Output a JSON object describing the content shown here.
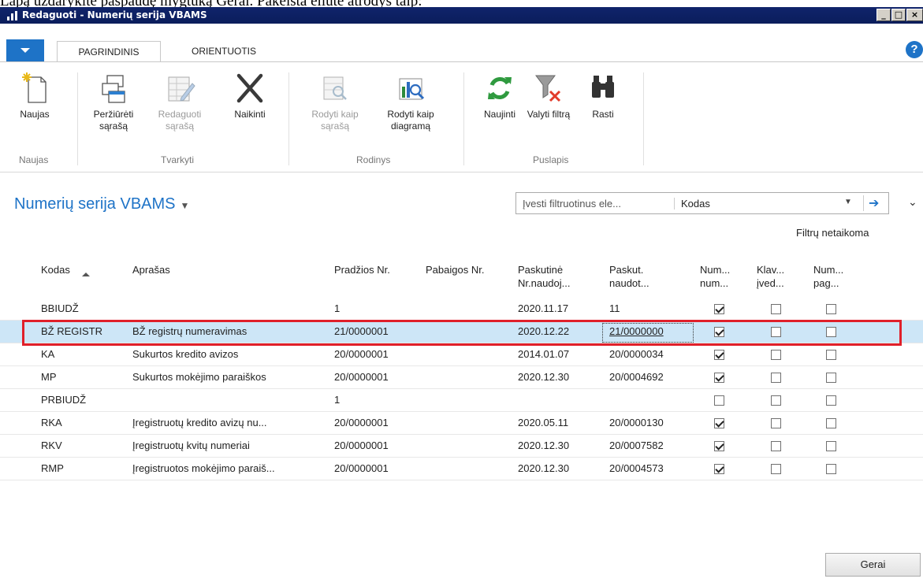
{
  "caption": "Lapą uždarykite paspaudę mygtuką Gerai. Pakeista eilutė atrodys taip:",
  "window": {
    "title": "Redaguoti - Numerių serija VBAMS",
    "controls": [
      "_",
      "□",
      "×"
    ]
  },
  "tabs": [
    {
      "label": "PAGRINDINIS",
      "active": true
    },
    {
      "label": "ORIENTUOTIS",
      "active": false
    }
  ],
  "help_label": "?",
  "ribbon": {
    "buttons": [
      {
        "label": "Naujas",
        "icon": "new-document-icon"
      },
      {
        "label": "Peržiūrėti sąrašą",
        "icon": "view-list-icon"
      },
      {
        "label": "Redaguoti sąrašą",
        "icon": "edit-list-icon",
        "disabled": true
      },
      {
        "label": "Naikinti",
        "icon": "delete-x-icon"
      },
      {
        "label": "Rodyti kaip sąrašą",
        "icon": "show-as-list-icon",
        "disabled": true
      },
      {
        "label": "Rodyti kaip diagramą",
        "icon": "show-as-chart-icon"
      },
      {
        "label": "Naujinti",
        "icon": "refresh-icon"
      },
      {
        "label": "Valyti filtrą",
        "icon": "clear-filter-icon"
      },
      {
        "label": "Rasti",
        "icon": "binoculars-icon"
      }
    ],
    "groups": [
      "Naujas",
      "Tvarkyti",
      "Rodinys",
      "Puslapis"
    ]
  },
  "page_title": "Numerių serija VBAMS",
  "filter": {
    "placeholder": "Įvesti filtruotinus ele...",
    "field": "Kodas",
    "status": "Filtrų netaikoma"
  },
  "columns": [
    "Kodas",
    "Aprašas",
    "Pradžios Nr.",
    "Pabaigos Nr.",
    "Paskutinė Nr.naudoj...",
    "Paskut. naudot...",
    "Num... num...",
    "Klav... įved...",
    "Num... pag..."
  ],
  "rows": [
    {
      "kodas": "BBIUDŽ",
      "aprasas": "",
      "pradzios": "1",
      "pabaigos": "",
      "data": "2020.11.17",
      "paskut": "11",
      "c1": true,
      "c2": false,
      "c3": false
    },
    {
      "kodas": "BŽ REGISTR",
      "aprasas": "BŽ registrų numeravimas",
      "pradzios": "21/0000001",
      "pabaigos": "",
      "data": "2020.12.22",
      "paskut": "21/0000000",
      "c1": true,
      "c2": false,
      "c3": false,
      "selected": true
    },
    {
      "kodas": "KA",
      "aprasas": "Sukurtos kredito avizos",
      "pradzios": "20/0000001",
      "pabaigos": "",
      "data": "2014.01.07",
      "paskut": "20/0000034",
      "c1": true,
      "c2": false,
      "c3": false
    },
    {
      "kodas": "MP",
      "aprasas": "Sukurtos mokėjimo paraiškos",
      "pradzios": "20/0000001",
      "pabaigos": "",
      "data": "2020.12.30",
      "paskut": "20/0004692",
      "c1": true,
      "c2": false,
      "c3": false
    },
    {
      "kodas": "PRBIUDŽ",
      "aprasas": "",
      "pradzios": "1",
      "pabaigos": "",
      "data": "",
      "paskut": "",
      "c1": false,
      "c2": false,
      "c3": false
    },
    {
      "kodas": "RKA",
      "aprasas": "Įregistruotų kredito avizų nu...",
      "pradzios": "20/0000001",
      "pabaigos": "",
      "data": "2020.05.11",
      "paskut": "20/0000130",
      "c1": true,
      "c2": false,
      "c3": false
    },
    {
      "kodas": "RKV",
      "aprasas": "Įregistruotų kvitų numeriai",
      "pradzios": "20/0000001",
      "pabaigos": "",
      "data": "2020.12.30",
      "paskut": "20/0007582",
      "c1": true,
      "c2": false,
      "c3": false
    },
    {
      "kodas": "RMP",
      "aprasas": "Įregistruotos mokėjimo paraiš...",
      "pradzios": "20/0000001",
      "pabaigos": "",
      "data": "2020.12.30",
      "paskut": "20/0004573",
      "c1": true,
      "c2": false,
      "c3": false
    }
  ],
  "ok_label": "Gerai"
}
